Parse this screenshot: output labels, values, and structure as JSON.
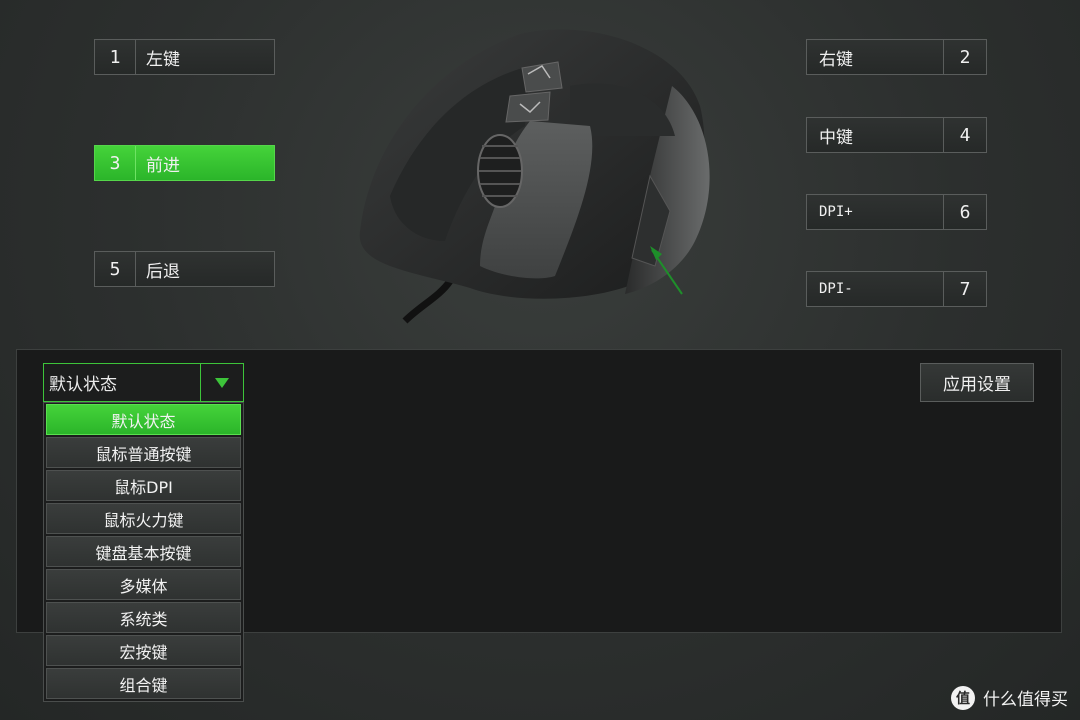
{
  "left_buttons": [
    {
      "num": "1",
      "label": "左键"
    },
    {
      "num": "3",
      "label": "前进"
    },
    {
      "num": "5",
      "label": "后退"
    }
  ],
  "right_buttons": [
    {
      "num": "2",
      "label": "右键"
    },
    {
      "num": "4",
      "label": "中键"
    },
    {
      "num": "6",
      "label": "DPI+"
    },
    {
      "num": "7",
      "label": "DPI-"
    }
  ],
  "active_button": "3",
  "accent_color": "#3dc43a",
  "function_select": {
    "value": "默认状态",
    "options": [
      "默认状态",
      "鼠标普通按键",
      "鼠标DPI",
      "鼠标火力键",
      "键盘基本按键",
      "多媒体",
      "系统类",
      "宏按键",
      "组合键"
    ]
  },
  "apply_label": "应用设置",
  "watermark": {
    "logo": "值",
    "text": "什么值得买"
  }
}
